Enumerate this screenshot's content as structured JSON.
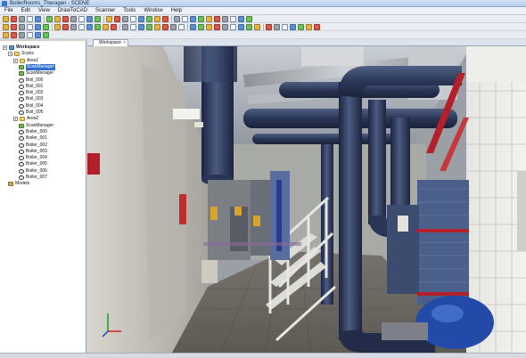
{
  "window": {
    "title": "BoilerRooms_Theragen - SCENE"
  },
  "menu": [
    "File",
    "Edit",
    "View",
    "DrawToCAD",
    "Scanner",
    "Tools",
    "Window",
    "Help"
  ],
  "tab": {
    "label": "Workspace",
    "close": "×"
  },
  "tree": [
    {
      "label": "Workspace",
      "depth": 0,
      "icon": "workspace-icon",
      "bold": true
    },
    {
      "label": "Scans",
      "depth": 1,
      "icon": "folder-icon"
    },
    {
      "label": "Area1",
      "depth": 2,
      "icon": "folder-icon"
    },
    {
      "label": "ScanManager",
      "depth": 3,
      "icon": "scan-manager-icon",
      "selected": true
    },
    {
      "label": "ScanManager",
      "depth": 3,
      "icon": "scan-manager-icon"
    },
    {
      "label": "Boil_000",
      "depth": 3,
      "icon": "scan-icon"
    },
    {
      "label": "Boil_001",
      "depth": 3,
      "icon": "scan-icon"
    },
    {
      "label": "Boil_002",
      "depth": 3,
      "icon": "scan-icon"
    },
    {
      "label": "Boil_003",
      "depth": 3,
      "icon": "scan-icon"
    },
    {
      "label": "Boil_004",
      "depth": 3,
      "icon": "scan-icon"
    },
    {
      "label": "Boil_005",
      "depth": 3,
      "icon": "scan-icon"
    },
    {
      "label": "Area2",
      "depth": 2,
      "icon": "folder-icon"
    },
    {
      "label": "ScanManager",
      "depth": 3,
      "icon": "scan-manager-icon"
    },
    {
      "label": "Boiler_000",
      "depth": 3,
      "icon": "scan-icon"
    },
    {
      "label": "Boiler_001",
      "depth": 3,
      "icon": "scan-icon"
    },
    {
      "label": "Boiler_002",
      "depth": 3,
      "icon": "scan-icon"
    },
    {
      "label": "Boiler_003",
      "depth": 3,
      "icon": "scan-icon"
    },
    {
      "label": "Boiler_004",
      "depth": 3,
      "icon": "scan-icon"
    },
    {
      "label": "Boiler_005",
      "depth": 3,
      "icon": "scan-icon"
    },
    {
      "label": "Boiler_006",
      "depth": 3,
      "icon": "scan-icon"
    },
    {
      "label": "Boiler_007",
      "depth": 3,
      "icon": "scan-icon"
    },
    {
      "label": "Models",
      "depth": 1,
      "icon": "models-icon"
    }
  ],
  "colors": {
    "selection": "#2f6fcf",
    "pipe": "#2c3a5a",
    "heat_exchanger": "#4a5f8a",
    "rail_red": "#b3202a",
    "railing": "#e6e6e4"
  }
}
